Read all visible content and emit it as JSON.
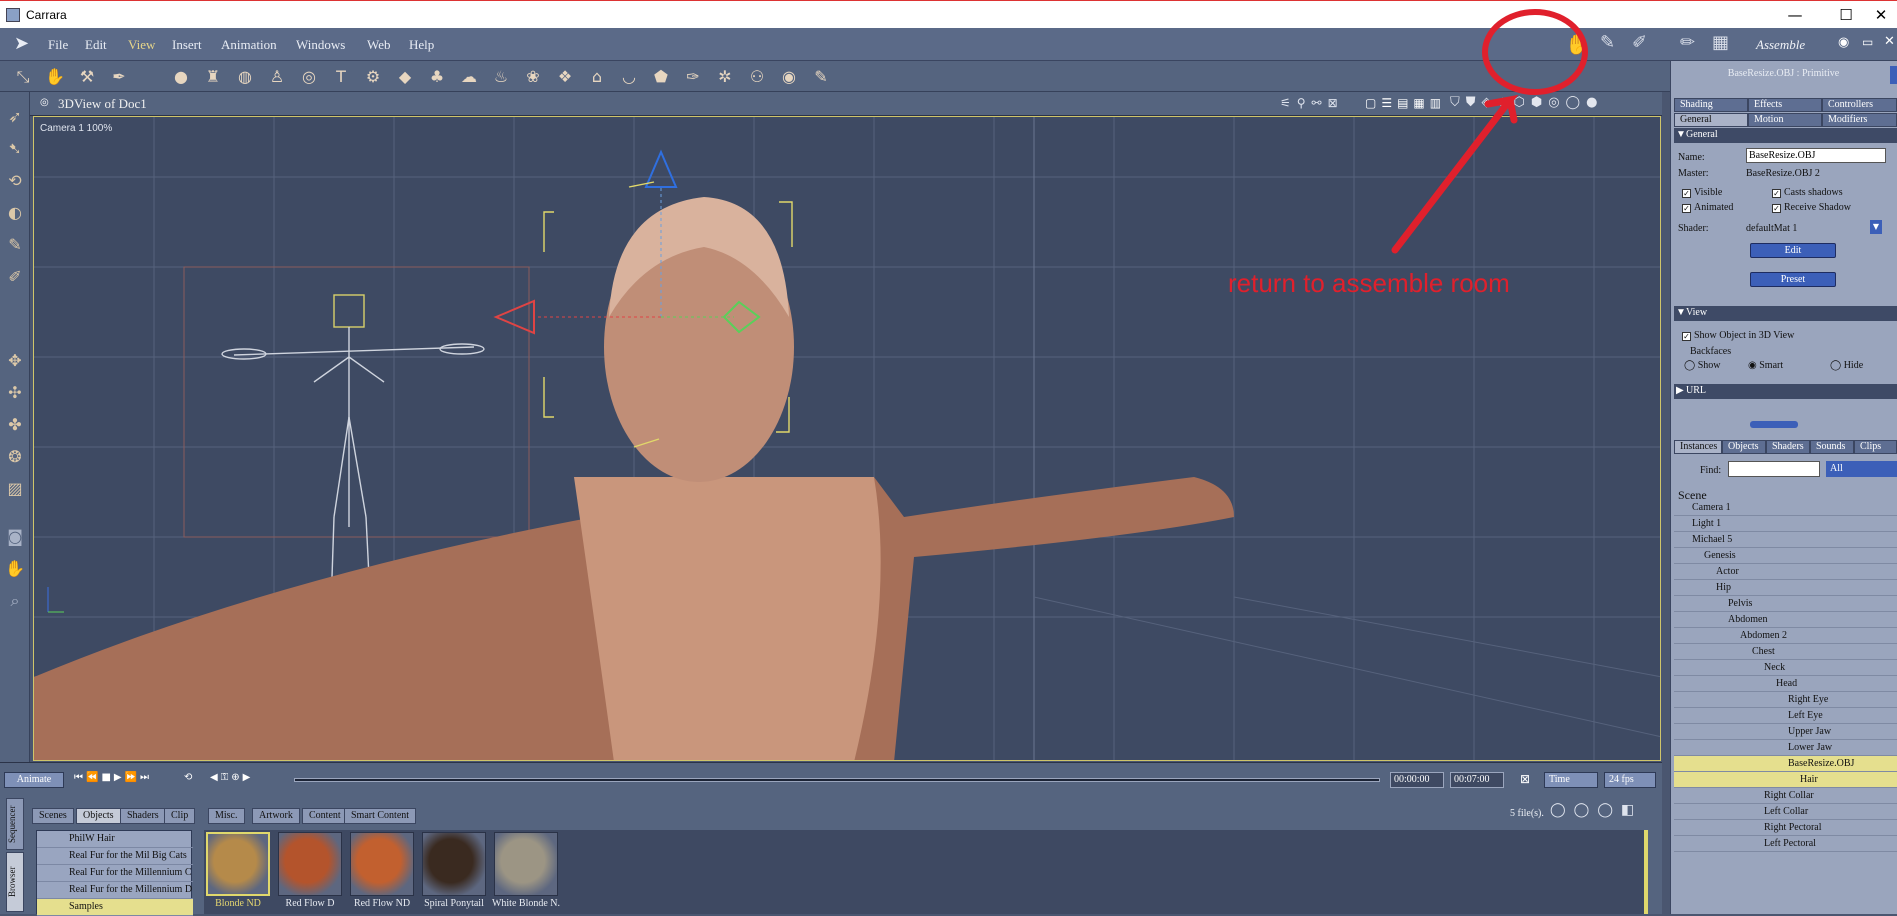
{
  "window": {
    "title": "Carrara",
    "min": "—",
    "max": "☐",
    "close": "✕"
  },
  "menu": [
    "File",
    "Edit",
    "View",
    "Insert",
    "Animation",
    "Windows",
    "Web",
    "Help"
  ],
  "room": {
    "label": "Assemble"
  },
  "view": {
    "title": "3DView of Doc1",
    "camera_label": "Camera 1 100%"
  },
  "annotation": {
    "text": "return to assemble room",
    "color": "#e0202c"
  },
  "timeline": {
    "animate_label": "Animate",
    "time_current": "00:00:00",
    "time_end": "00:07:00",
    "time_mode": "Time",
    "fps": "24 fps"
  },
  "browser": {
    "tabs": [
      "Scenes",
      "Objects",
      "Shaders",
      "Clip",
      "Misc.",
      "Artwork",
      "Content",
      "Smart Content"
    ],
    "active_tab": "Objects",
    "side_tabs": [
      "Sequencer",
      "Browser"
    ],
    "files_count": "5 file(s).",
    "categories": [
      "PhilW Hair",
      "Real Fur for the Mil Big Cats",
      "Real Fur for the Millennium C",
      "Real Fur for the Millennium D",
      "Samples"
    ],
    "items": [
      {
        "label": "Blonde ND",
        "color": "#b58a4a",
        "selected": true
      },
      {
        "label": "Red Flow D",
        "color": "#b4542c",
        "selected": false
      },
      {
        "label": "Red Flow ND",
        "color": "#c2602f",
        "selected": false
      },
      {
        "label": "Spiral Ponytail",
        "color": "#3a2a20",
        "selected": false
      },
      {
        "label": "White Blonde N.",
        "color": "#9c9584",
        "selected": false
      }
    ]
  },
  "properties": {
    "header": "BaseResize.OBJ : Primitive",
    "tabs_row1": [
      "Shading",
      "Effects",
      "Controllers"
    ],
    "tabs_row2": [
      "General",
      "Motion",
      "Modifiers"
    ],
    "general_section": "General",
    "name_label": "Name:",
    "name_value": "BaseResize.OBJ",
    "master_label": "Master:",
    "master_value": "BaseResize.OBJ 2",
    "visible": "Visible",
    "casts_shadows": "Casts shadows",
    "animated": "Animated",
    "receive_shadow": "Receive Shadow",
    "shader_label": "Shader:",
    "shader_value": "defaultMat 1",
    "edit_btn": "Edit",
    "preset_btn": "Preset",
    "view_section": "View",
    "show_in_3d": "Show Object in 3D View",
    "backfaces": "Backfaces",
    "bf_show": "Show",
    "bf_smart": "Smart",
    "bf_hide": "Hide",
    "url_section": "URL"
  },
  "scene": {
    "tabs": [
      "Instances",
      "Objects",
      "Shaders",
      "Sounds",
      "Clips"
    ],
    "find_label": "Find:",
    "filter": "All",
    "root": "Scene",
    "tree": [
      {
        "label": "Camera 1",
        "depth": 0
      },
      {
        "label": "Light 1",
        "depth": 0
      },
      {
        "label": "Michael 5",
        "depth": 0
      },
      {
        "label": "Genesis",
        "depth": 1
      },
      {
        "label": "Actor",
        "depth": 2
      },
      {
        "label": "Hip",
        "depth": 2
      },
      {
        "label": "Pelvis",
        "depth": 3
      },
      {
        "label": "Abdomen",
        "depth": 3
      },
      {
        "label": "Abdomen 2",
        "depth": 4
      },
      {
        "label": "Chest",
        "depth": 5
      },
      {
        "label": "Neck",
        "depth": 6
      },
      {
        "label": "Head",
        "depth": 7
      },
      {
        "label": "Right Eye",
        "depth": 8
      },
      {
        "label": "Left Eye",
        "depth": 8
      },
      {
        "label": "Upper Jaw",
        "depth": 8
      },
      {
        "label": "Lower Jaw",
        "depth": 8
      },
      {
        "label": "BaseResize.OBJ",
        "depth": 8,
        "selected": true
      },
      {
        "label": "Hair",
        "depth": 9,
        "selected": true
      },
      {
        "label": "Right Collar",
        "depth": 6
      },
      {
        "label": "Left Collar",
        "depth": 6
      },
      {
        "label": "Right Pectoral",
        "depth": 6
      },
      {
        "label": "Left Pectoral",
        "depth": 6
      }
    ]
  }
}
